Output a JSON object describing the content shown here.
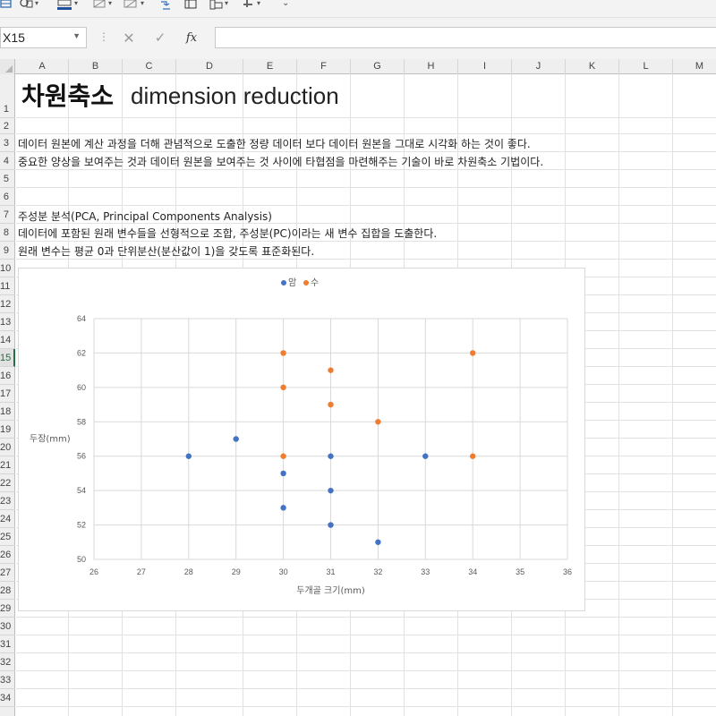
{
  "ribbon": {
    "icons": [
      "table-style-icon",
      "shape-icon",
      "font-color-icon",
      "format-painter-icon",
      "eraser-icon",
      "fill-icon",
      "table-icon",
      "sort-icon",
      "more-icon"
    ]
  },
  "formula_bar": {
    "name_box": "X15",
    "fx_label": "fx",
    "formula": ""
  },
  "columns": [
    "A",
    "B",
    "C",
    "D",
    "E",
    "F",
    "G",
    "H",
    "I",
    "J",
    "K",
    "L",
    "M"
  ],
  "rows": [
    "1",
    "2",
    "3",
    "4",
    "5",
    "6",
    "7",
    "8",
    "9",
    "10",
    "11",
    "12",
    "13",
    "14",
    "15",
    "16",
    "17",
    "18",
    "19",
    "20",
    "21",
    "22",
    "23",
    "24",
    "25",
    "26",
    "27",
    "28",
    "29",
    "30",
    "31",
    "32",
    "33",
    "34"
  ],
  "selected_row": "15",
  "sheet": {
    "title_ko": "차원축소",
    "title_en": "dimension reduction",
    "line3": "데이터 원본에 계산 과정을 더해 관념적으로 도출한 정량 데이터 보다 데이터 원본을 그대로 시각화 하는 것이 좋다.",
    "line4": "중요한 양상을 보여주는 것과 데이터 원본을 보여주는 것 사이에 타협점을 마련해주는 기술이 바로 차원축소 기법이다.",
    "line7": "주성분 분석(PCA, Principal Components Analysis)",
    "line8": "데이터에 포함된 원래 변수들을 선형적으로 조합, 주성분(PC)이라는 새 변수 집합을 도출한다.",
    "line9": "원래 변수는 평균 0과 단위분산(분산값이 1)을 갖도록 표준화된다."
  },
  "chart_data": {
    "type": "scatter",
    "xlabel": "두개골 크기(mm)",
    "ylabel": "두장(mm)",
    "xlim": [
      26,
      36
    ],
    "ylim": [
      50,
      64
    ],
    "xticks": [
      26,
      27,
      28,
      29,
      30,
      31,
      32,
      33,
      34,
      35,
      36
    ],
    "yticks": [
      50,
      52,
      54,
      56,
      58,
      60,
      62,
      64
    ],
    "grid": true,
    "legend_position": "top",
    "series": [
      {
        "name": "암",
        "color": "#4472c4",
        "points": [
          [
            28,
            56
          ],
          [
            29,
            57
          ],
          [
            30,
            55
          ],
          [
            30,
            53
          ],
          [
            31,
            56
          ],
          [
            31,
            54
          ],
          [
            31,
            52
          ],
          [
            32,
            51
          ],
          [
            33,
            56
          ]
        ]
      },
      {
        "name": "수",
        "color": "#ed7d31",
        "points": [
          [
            30,
            62
          ],
          [
            30,
            60
          ],
          [
            30,
            56
          ],
          [
            31,
            61
          ],
          [
            31,
            59
          ],
          [
            32,
            58
          ],
          [
            34,
            62
          ],
          [
            34,
            56
          ]
        ]
      }
    ]
  }
}
